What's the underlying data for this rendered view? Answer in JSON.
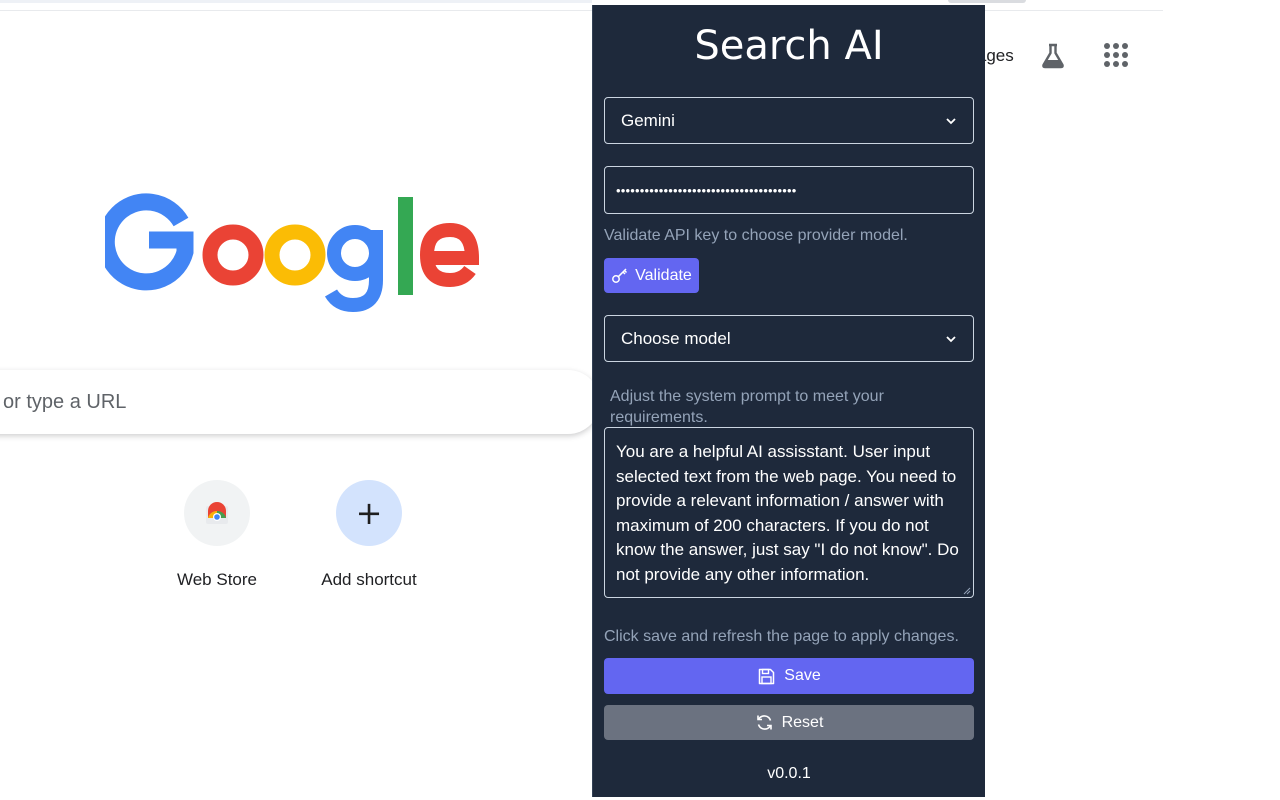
{
  "browser": {
    "images_link": "Images",
    "search_placeholder": "Search Google or type a URL",
    "search_placeholder_visible": "or type a URL",
    "shortcuts": [
      {
        "label": "Web Store",
        "icon": "chrome-webstore-icon"
      },
      {
        "label": "Add shortcut",
        "icon": "plus-icon"
      }
    ],
    "icons": [
      "labs-flask-icon",
      "apps-grid-icon"
    ],
    "logo_text": "Google"
  },
  "popup": {
    "title": "Search AI",
    "provider": {
      "selected": "Gemini"
    },
    "api_key": {
      "masked_value": "••••••••••••••••••••••••••••••••••••••"
    },
    "validate_hint": "Validate API key to choose provider model.",
    "validate_label": "Validate",
    "model": {
      "selected": "Choose model"
    },
    "prompt_hint": "Adjust the system prompt to meet your requirements.",
    "system_prompt": "You are a helpful AI assisstant. User input selected text from the web page. You need to provide a relevant information / answer with maximum of 200 characters. If you do not know the answer, just say \"I do not know\". Do not provide any other information.",
    "save_hint": "Click save and refresh the page to apply changes.",
    "save_label": "Save",
    "reset_label": "Reset",
    "version": "v0.0.1"
  },
  "colors": {
    "popup_bg": "#1e293b",
    "accent": "#6366f1",
    "reset_button": "#6b7280",
    "muted_text": "#94a3b8",
    "google_blue": "#4285f4",
    "google_red": "#ea4335",
    "google_yellow": "#fbbc05",
    "google_green": "#34a853"
  }
}
